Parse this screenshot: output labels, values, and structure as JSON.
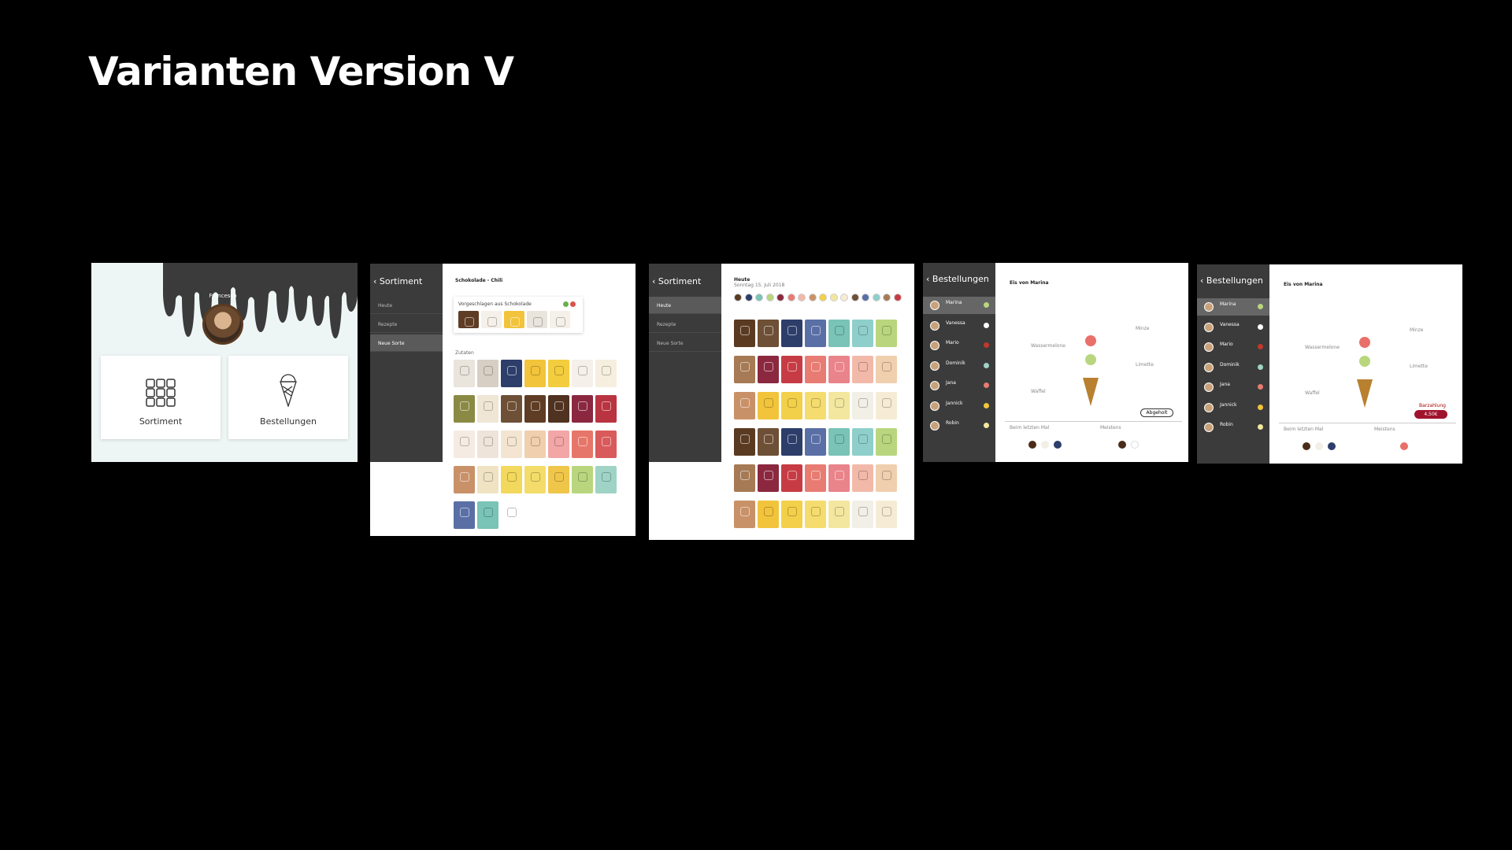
{
  "slide": {
    "title": "Varianten Version V"
  },
  "panel1": {
    "user": "Francesco",
    "card1": "Sortiment",
    "card2": "Bestellungen"
  },
  "panel2": {
    "back": "Sortiment",
    "nav": [
      "Heute",
      "Rezepte",
      "Neue Sorte"
    ],
    "header": "Schokolade - Chili",
    "suggest": "Vorgeschlagen aus Schokolade",
    "zutaten": "Zutaten"
  },
  "panel3": {
    "back": "Sortiment",
    "nav": [
      "Heute",
      "Rezepte",
      "Neue Sorte"
    ],
    "heute": "Heute",
    "date": "Sonntag 15. Juli 2018"
  },
  "panel4": {
    "back": "Bestellungen",
    "heading": "Eis von Marina",
    "names": [
      "Marina",
      "Vanessa",
      "Mario",
      "Dominik",
      "Jana",
      "Jannick",
      "Robin"
    ],
    "labels": {
      "minze": "Minze",
      "wasser": "Wassermelone",
      "limette": "Limette",
      "waffel": "Waffel"
    },
    "status": "Abgeholt",
    "last": "Beim letzten Mal",
    "meistens": "Meistens"
  },
  "panel5": {
    "back": "Bestellungen",
    "heading": "Eis von Marina",
    "names": [
      "Marina",
      "Vanessa",
      "Mario",
      "Dominik",
      "Jana",
      "Jannick",
      "Robin"
    ],
    "labels": {
      "minze": "Minze",
      "wasser": "Wassermelone",
      "limette": "Limette",
      "waffel": "Waffel"
    },
    "pay": "Barzahlung",
    "price": "4,50€",
    "last": "Beim letzten Mal",
    "meistens": "Meistens"
  },
  "colors": {
    "grid": [
      "#e9e4dc",
      "#d7cfc4",
      "#2e3e6b",
      "#f2c43b",
      "#f3cd3e",
      "#f5f0e9",
      "#f6efdf",
      "#8a8a45",
      "#efe6d6",
      "#6e5037",
      "#5e3d24",
      "#503220",
      "#8b2840",
      "#b93440",
      "#f5ebe2",
      "#efe4da",
      "#f3e5d2",
      "#f0cfae",
      "#f2a6a6",
      "#e7766a",
      "#d95a5a",
      "#c99168",
      "#efe3c4",
      "#f2d85c",
      "#f3dc6a",
      "#f0c64a",
      "#b9d67e",
      "#9fd3c6",
      "#5a6fa5",
      "#79c3b7",
      "#ffffff"
    ],
    "sorten": [
      "#5a3b22",
      "#6e5037",
      "#2e3e6b",
      "#5a6fa5",
      "#79c3b7",
      "#8fcfcb",
      "#b9d67e",
      "#a57a55",
      "#8b2840",
      "#c73c44",
      "#e87c72",
      "#e9848a",
      "#f2b9a9",
      "#f0cfae",
      "#c99168",
      "#f2c43b",
      "#f3d04a",
      "#f5dc6e",
      "#f3e7a0",
      "#f2efe6",
      "#f6ecd6"
    ]
  }
}
